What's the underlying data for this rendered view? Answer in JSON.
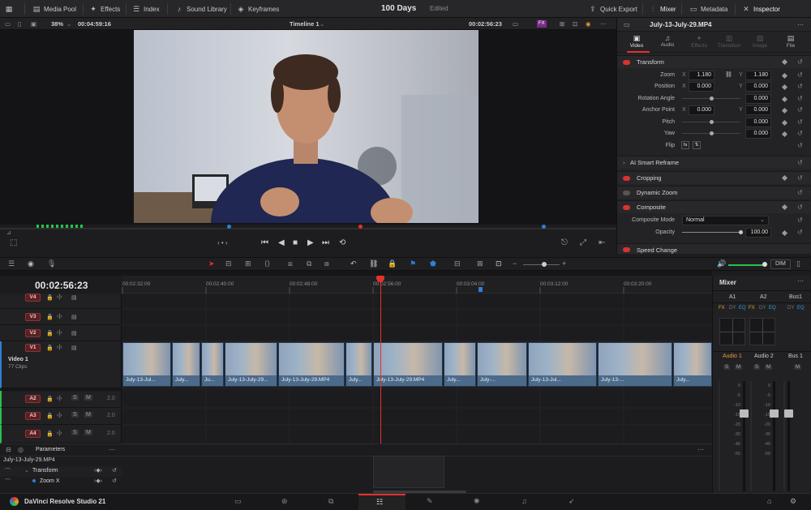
{
  "topbar": {
    "media_pool": "Media Pool",
    "effects": "Effects",
    "index": "Index",
    "sound_library": "Sound Library",
    "keyframes": "Keyframes",
    "project_title": "100 Days",
    "project_status": "Edited",
    "quick_export": "Quick Export",
    "mixer": "Mixer",
    "metadata": "Metadata",
    "inspector": "Inspector"
  },
  "viewer": {
    "zoom": "38%",
    "source_timecode": "00:04:59:16",
    "timeline_name": "Timeline 1",
    "record_timecode": "00:02:56:23",
    "fx_badge": "FX"
  },
  "inspector": {
    "clip_name": "July-13-July-29.MP4",
    "tabs": [
      "Video",
      "Audio",
      "Effects",
      "Transition",
      "Image",
      "File"
    ],
    "transform_title": "Transform",
    "zoom_label": "Zoom",
    "zoom_x": "1.180",
    "zoom_y": "1.180",
    "position_label": "Position",
    "position_x": "0.000",
    "position_y": "0.000",
    "rotation_label": "Rotation Angle",
    "rotation_value": "0.000",
    "anchor_label": "Anchor Point",
    "anchor_x": "0.000",
    "anchor_y": "0.000",
    "pitch_label": "Pitch",
    "pitch_value": "0.000",
    "yaw_label": "Yaw",
    "yaw_value": "0.000",
    "flip_label": "Flip",
    "x_label": "X",
    "y_label": "Y",
    "smart_reframe": "AI Smart Reframe",
    "cropping": "Cropping",
    "dynamic_zoom": "Dynamic Zoom",
    "composite": "Composite",
    "composite_mode_label": "Composite Mode",
    "composite_mode_value": "Normal",
    "opacity_label": "Opacity",
    "opacity_value": "100.00",
    "speed_change": "Speed Change"
  },
  "timeline": {
    "timecode": "00:02:56:23",
    "ruler_labels": [
      "00:02:32:00",
      "00:02:40:00",
      "00:02:48:00",
      "00:02:56:00",
      "00:03:04:00",
      "00:03:12:00",
      "00:03:20:00"
    ],
    "video_tracks": [
      "V4",
      "V3",
      "V2",
      "V1"
    ],
    "video1_name": "Video 1",
    "video1_clips": "77 Clips",
    "audio_tracks": [
      "A2",
      "A3",
      "A4"
    ],
    "audio_level": "2.0",
    "clip_names": [
      "July-13-Jul...",
      "July...",
      "Ju...",
      "July-13-July-29...",
      "July-13-July-29.MP4",
      "July...",
      "July-13-July-29.MP4",
      "July...",
      "July-...",
      "July-13-Jul...",
      "July-13-...",
      "July..."
    ],
    "dim_label": "DIM"
  },
  "mixer": {
    "title": "Mixer",
    "channels": [
      "A1",
      "A2",
      "Bus1"
    ],
    "fx": "FX",
    "dy": "DY",
    "eq": "EQ",
    "strip_names": [
      "Audio 1",
      "Audio 2",
      "Bus 1"
    ],
    "solo": "S",
    "mute": "M",
    "scale": [
      "0",
      "-5",
      "-10",
      "-15",
      "-20",
      "-30",
      "-40",
      "-50"
    ]
  },
  "params": {
    "title": "Parameters",
    "clip": "July-13-July-29.MP4",
    "transform": "Transform",
    "zoom_x": "Zoom X"
  },
  "status": {
    "app_name": "DaVinci Resolve Studio 21"
  },
  "colors": {
    "playhead": "#e6312b",
    "accent_blue": "#2f7fd6",
    "clip_blue": "#4c6a8a",
    "record_red": "#d8332e",
    "meter_green": "#27c24a"
  }
}
